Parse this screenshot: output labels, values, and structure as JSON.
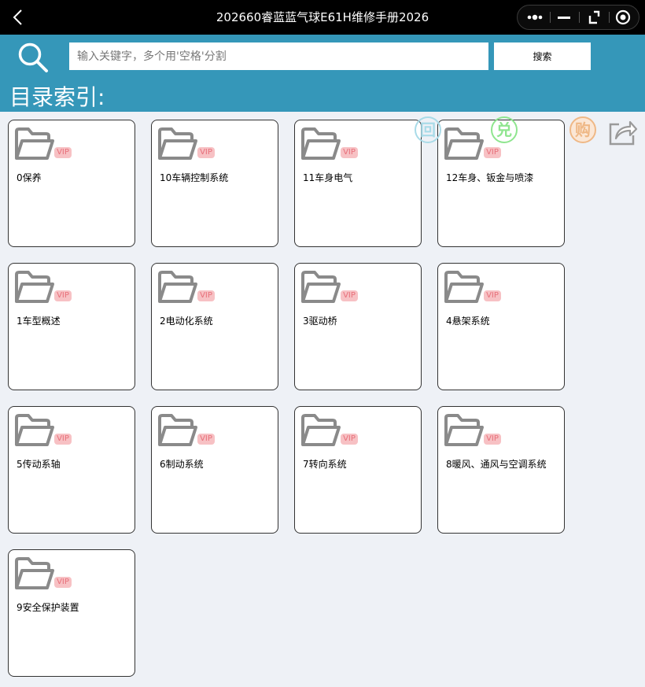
{
  "window": {
    "title": "202660睿蓝蓝气球E61H维修手册2026",
    "back_icon": "chevron-left-icon",
    "capsule_icons": [
      "more-icon",
      "minimize-icon",
      "restore-icon",
      "close-circle-icon"
    ]
  },
  "search": {
    "placeholder": "输入关键字，多个用'空格'分割",
    "value": "",
    "button_label": "搜索",
    "icon": "search-icon"
  },
  "section": {
    "title": "目录索引:"
  },
  "actions": {
    "home_label": "回",
    "redeem_label": "兑",
    "buy_label": "购",
    "share_icon": "share-icon",
    "colors": {
      "home": "#a9dbe8",
      "redeem": "#8fe58f",
      "buy": "#efb886",
      "share": "#9a9a9a"
    }
  },
  "vip_label": "VIP",
  "colors": {
    "header": "#3597b9",
    "folder": "#8a8a8a",
    "vip_bg": "#f7c1c4",
    "vip_text": "#e8707a"
  },
  "folders": [
    {
      "label": "0保养"
    },
    {
      "label": "10车辆控制系统"
    },
    {
      "label": "11车身电气"
    },
    {
      "label": "12车身、钣金与喷漆"
    },
    {
      "label": "1车型概述"
    },
    {
      "label": "2电动化系统"
    },
    {
      "label": "3驱动桥"
    },
    {
      "label": "4悬架系统"
    },
    {
      "label": "5传动系轴"
    },
    {
      "label": "6制动系统"
    },
    {
      "label": "7转向系统"
    },
    {
      "label": "8暖风、通风与空调系统"
    },
    {
      "label": "9安全保护装置"
    }
  ]
}
